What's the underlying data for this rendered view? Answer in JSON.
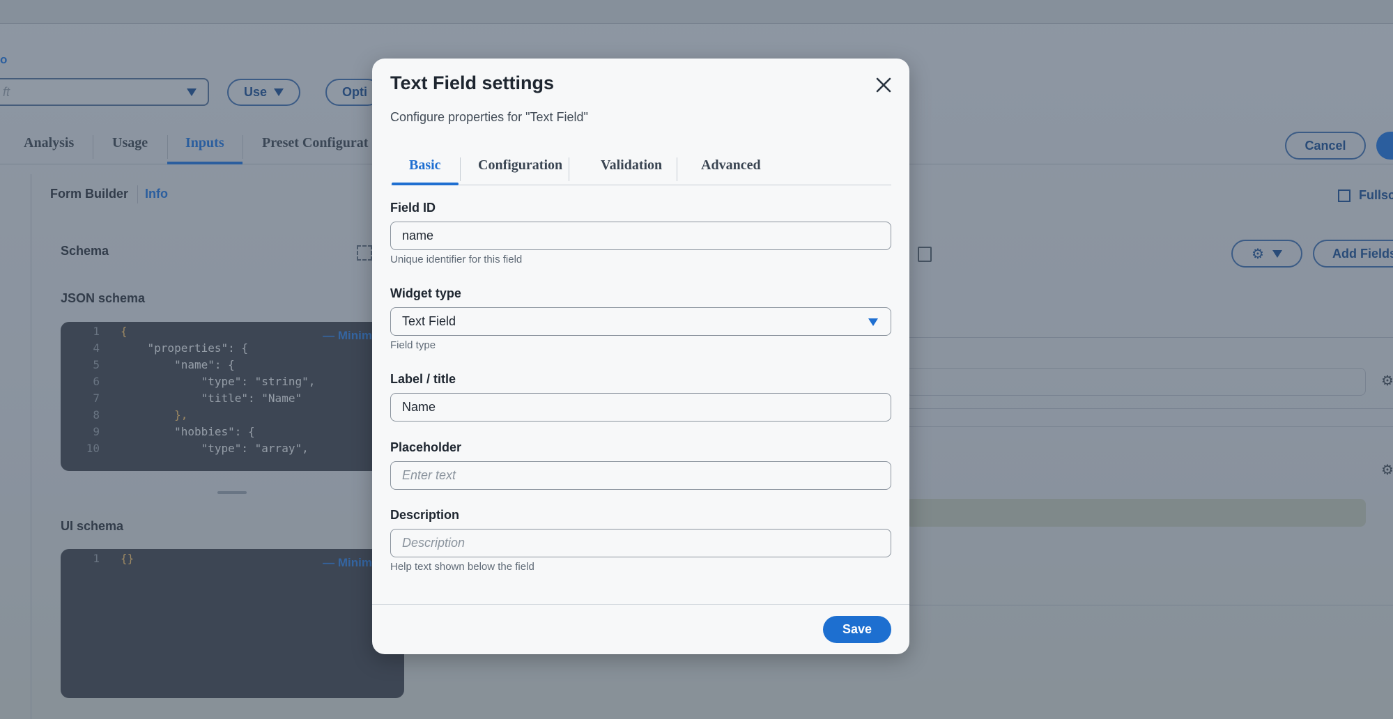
{
  "background": {
    "breadcrumb_fragment": "o",
    "select_placeholder": "ft",
    "use_button": "Use",
    "options_button": "Opti",
    "tabs": [
      "Analysis",
      "Usage",
      "Inputs",
      "Preset Configurat"
    ],
    "cancel_button": "Cancel",
    "form_builder": "Form Builder",
    "info_link": "Info",
    "fullscreen_label": "Fullsc",
    "schema_label": "Schema",
    "add_fields_button": "Add Fields",
    "json_schema_label": "JSON schema",
    "ui_schema_label": "UI schema",
    "minimize_label": "— Minim",
    "json_editor_lines": [
      {
        "n": "1",
        "t": "{"
      },
      {
        "n": "4",
        "t": "    \"properties\": {"
      },
      {
        "n": "5",
        "t": "        \"name\": {"
      },
      {
        "n": "6",
        "t": "            \"type\": \"string\","
      },
      {
        "n": "7",
        "t": "            \"title\": \"Name\""
      },
      {
        "n": "8",
        "t": "        },"
      },
      {
        "n": "9",
        "t": "        \"hobbies\": {"
      },
      {
        "n": "10",
        "t": "            \"type\": \"array\","
      }
    ],
    "ui_editor_lines": [
      {
        "n": "1",
        "t": "{}"
      }
    ]
  },
  "modal": {
    "title": "Text Field settings",
    "subtitle": "Configure properties for \"Text Field\"",
    "tabs": [
      {
        "label": "Basic",
        "active": true
      },
      {
        "label": "Configuration",
        "active": false
      },
      {
        "label": "Validation",
        "active": false
      },
      {
        "label": "Advanced",
        "active": false
      }
    ],
    "field_id": {
      "label": "Field ID",
      "value": "name",
      "help": "Unique identifier for this field"
    },
    "widget_type": {
      "label": "Widget type",
      "value": "Text Field",
      "help": "Field type"
    },
    "label_title": {
      "label": "Label / title",
      "value": "Name"
    },
    "placeholder": {
      "label": "Placeholder",
      "placeholder": "Enter text"
    },
    "description": {
      "label": "Description",
      "placeholder": "Description",
      "help": "Help text shown below the field"
    },
    "save_button": "Save"
  },
  "colors": {
    "accent": "#1f6fd1",
    "overlay": "#3c4858",
    "modal_bg": "#f7f8f9"
  },
  "icons": {
    "close": "close-icon",
    "select_caret": "chevron-down-icon",
    "gear": "gear-icon"
  }
}
